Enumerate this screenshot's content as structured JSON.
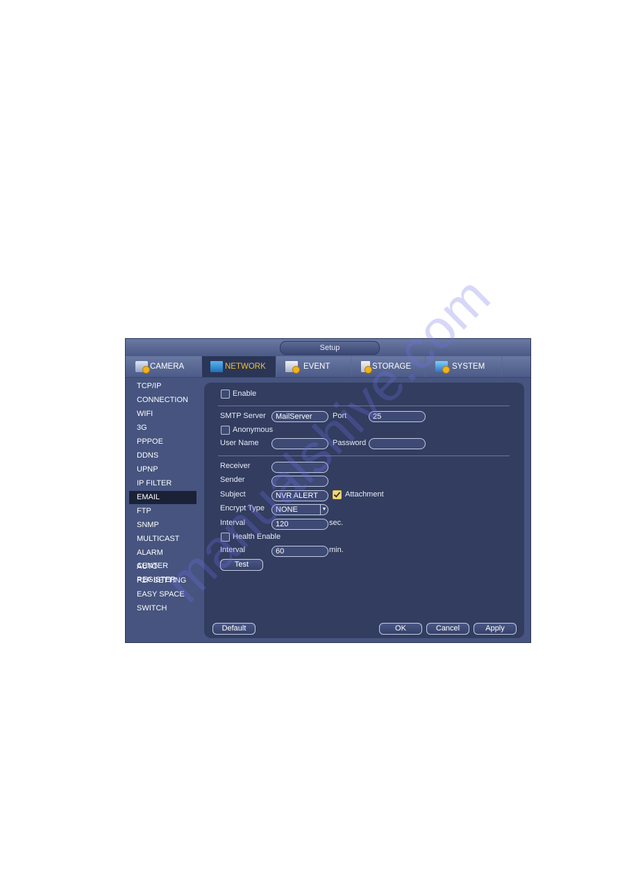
{
  "watermark": "manualshive.com",
  "window": {
    "title": "Setup",
    "tabs": [
      {
        "label": "CAMERA",
        "icon": "camera-settings-icon",
        "active": false
      },
      {
        "label": "NETWORK",
        "icon": "network-icon",
        "active": true
      },
      {
        "label": "EVENT",
        "icon": "event-icon",
        "active": false
      },
      {
        "label": "STORAGE",
        "icon": "storage-icon",
        "active": false
      },
      {
        "label": "SYSTEM",
        "icon": "system-icon",
        "active": false
      }
    ]
  },
  "sidebar": {
    "items": [
      {
        "label": "TCP/IP"
      },
      {
        "label": "CONNECTION"
      },
      {
        "label": "WIFI"
      },
      {
        "label": "3G"
      },
      {
        "label": "PPPOE"
      },
      {
        "label": "DDNS"
      },
      {
        "label": "UPNP"
      },
      {
        "label": "IP FILTER"
      },
      {
        "label": "EMAIL",
        "active": true
      },
      {
        "label": "FTP"
      },
      {
        "label": "SNMP"
      },
      {
        "label": "MULTICAST"
      },
      {
        "label": "ALARM CENTER"
      },
      {
        "label": "AUTO REGISTER"
      },
      {
        "label": "P2P SETTING"
      },
      {
        "label": "EASY SPACE"
      },
      {
        "label": "SWITCH"
      }
    ]
  },
  "email": {
    "enable": {
      "label": "Enable",
      "checked": false
    },
    "smtp_server": {
      "label": "SMTP Server",
      "value": "MailServer"
    },
    "port": {
      "label": "Port",
      "value": "25"
    },
    "anonymous": {
      "label": "Anonymous",
      "checked": false
    },
    "user_name": {
      "label": "User Name",
      "value": ""
    },
    "password": {
      "label": "Password",
      "value": ""
    },
    "receiver": {
      "label": "Receiver",
      "value": ""
    },
    "sender": {
      "label": "Sender",
      "value": ""
    },
    "subject": {
      "label": "Subject",
      "value": "NVR ALERT"
    },
    "attachment": {
      "label": "Attachment",
      "checked": true
    },
    "encrypt_type": {
      "label": "Encrypt Type",
      "value": "NONE"
    },
    "interval": {
      "label": "Interval",
      "value": "120",
      "unit": "sec."
    },
    "health_enable": {
      "label": "Health Enable",
      "checked": false
    },
    "health_interval": {
      "label": "Interval",
      "value": "60",
      "unit": "min."
    },
    "test_label": "Test"
  },
  "footer": {
    "default_label": "Default",
    "ok_label": "OK",
    "cancel_label": "Cancel",
    "apply_label": "Apply"
  }
}
